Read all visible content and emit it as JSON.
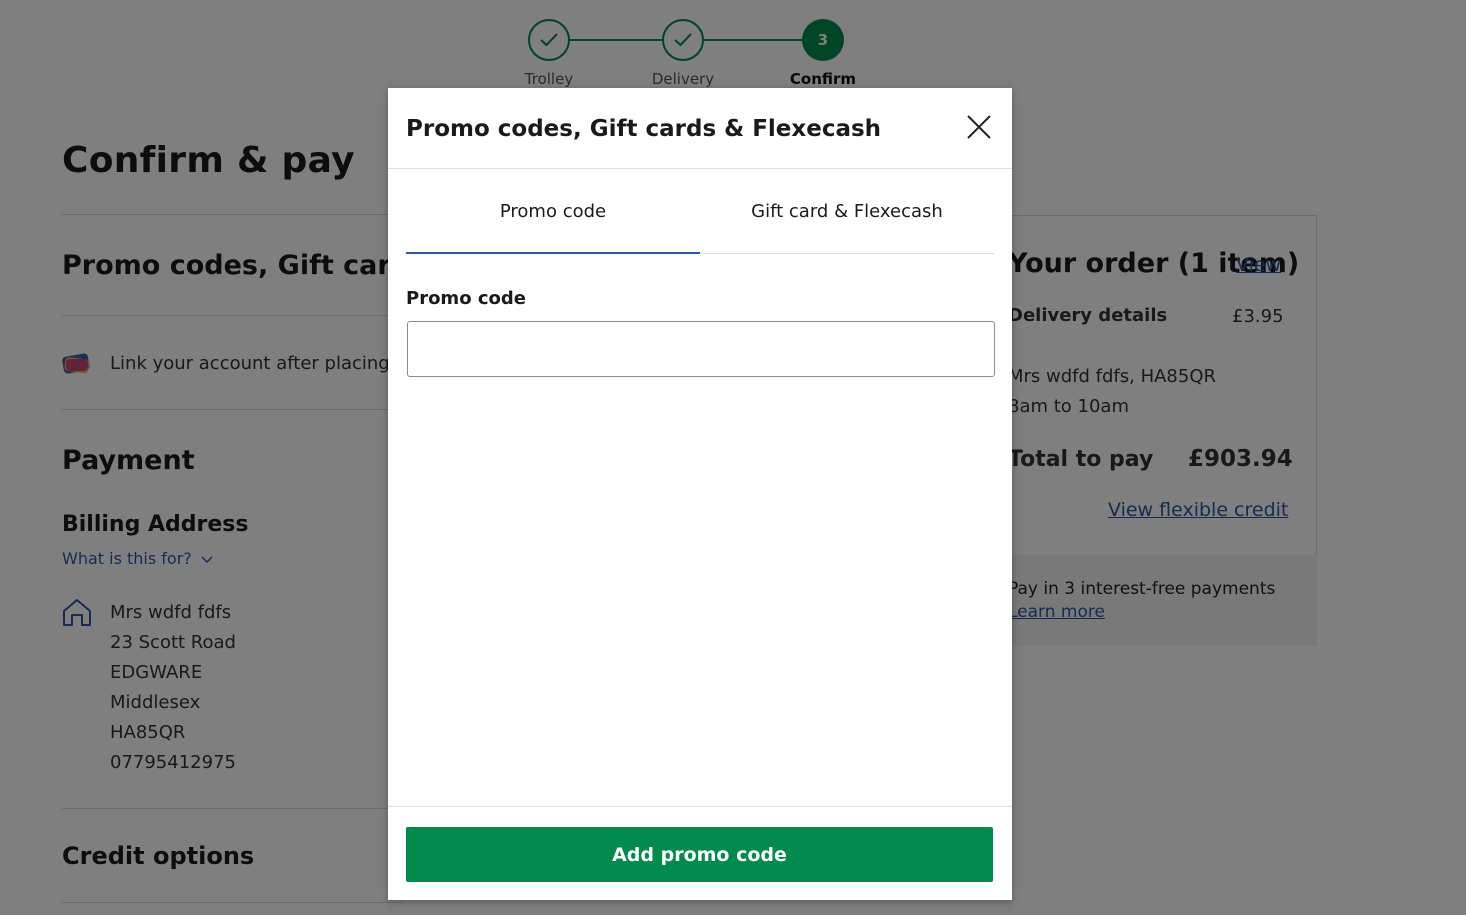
{
  "stepper": {
    "steps": [
      {
        "label": "Trolley",
        "state": "done"
      },
      {
        "label": "Delivery",
        "state": "done"
      },
      {
        "label": "Confirm",
        "state": "active",
        "number": "3"
      }
    ]
  },
  "page": {
    "title": "Confirm & pay",
    "promo_section_title": "Promo codes, Gift cards & Flexecash",
    "link_account_text": "Link your account after placing this order",
    "payment_title": "Payment",
    "billing_title": "Billing Address",
    "what_is_this": "What is this for?",
    "address": [
      "Mrs wdfd fdfs",
      "23 Scott Road",
      "EDGWARE",
      "Middlesex",
      "HA85QR",
      "07795412975"
    ],
    "credit_title": "Credit options"
  },
  "summary": {
    "title": "Your order (1 item)",
    "view_link": "View",
    "delivery_label": "Delivery details",
    "delivery_price": "£3.95",
    "delivery_address": "Mrs wdfd fdfs, HA85QR",
    "delivery_slot": "8am to 10am",
    "total_label": "Total to pay",
    "total_value": "£903.94",
    "flexible_credit_link": "View flexible credit",
    "interest_free_text": "Pay in 3 interest-free payments",
    "learn_more": "Learn more"
  },
  "modal": {
    "title": "Promo codes, Gift cards & Flexecash",
    "tabs": [
      {
        "label": "Promo code",
        "active": true
      },
      {
        "label": "Gift card & Flexecash",
        "active": false
      }
    ],
    "field_label": "Promo code",
    "field_value": "",
    "submit_label": "Add promo code"
  },
  "colors": {
    "brand_green": "#008a4b",
    "link_blue": "#2c57a6"
  }
}
